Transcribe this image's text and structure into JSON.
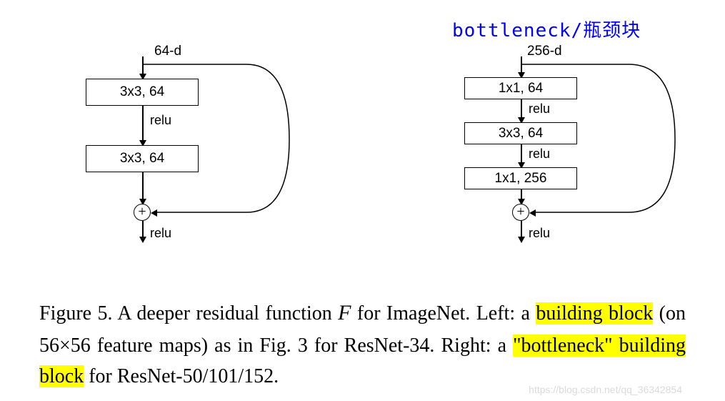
{
  "annotation": "bottleneck/瓶颈块",
  "left": {
    "input": "64-d",
    "box1": "3x3, 64",
    "box2": "3x3, 64",
    "relu": "relu"
  },
  "right": {
    "input": "256-d",
    "box1": "1x1, 64",
    "box2": "3x3, 64",
    "box3": "1x1, 256",
    "relu": "relu"
  },
  "caption": {
    "prefix": "Figure 5. A deeper residual function ",
    "scriptF": "F",
    "mid1": " for ImageNet.  Left: a ",
    "hl1": "building block",
    "mid2": " (on 56×56 feature maps) as in Fig. 3 for ResNet-34. Right: a ",
    "hl2": "\"bottleneck\" building block",
    "end": " for ResNet-50/101/152."
  },
  "watermark": "https://blog.csdn.net/qq_36342854",
  "chart_data": [
    {
      "type": "diagram",
      "name": "basic-residual-block",
      "input_dim": 64,
      "layers": [
        {
          "op": "conv",
          "kernel": "3x3",
          "channels": 64,
          "activation": "relu"
        },
        {
          "op": "conv",
          "kernel": "3x3",
          "channels": 64
        }
      ],
      "skip_connection": true,
      "post_add_activation": "relu"
    },
    {
      "type": "diagram",
      "name": "bottleneck-residual-block",
      "input_dim": 256,
      "layers": [
        {
          "op": "conv",
          "kernel": "1x1",
          "channels": 64,
          "activation": "relu"
        },
        {
          "op": "conv",
          "kernel": "3x3",
          "channels": 64,
          "activation": "relu"
        },
        {
          "op": "conv",
          "kernel": "1x1",
          "channels": 256
        }
      ],
      "skip_connection": true,
      "post_add_activation": "relu"
    }
  ]
}
